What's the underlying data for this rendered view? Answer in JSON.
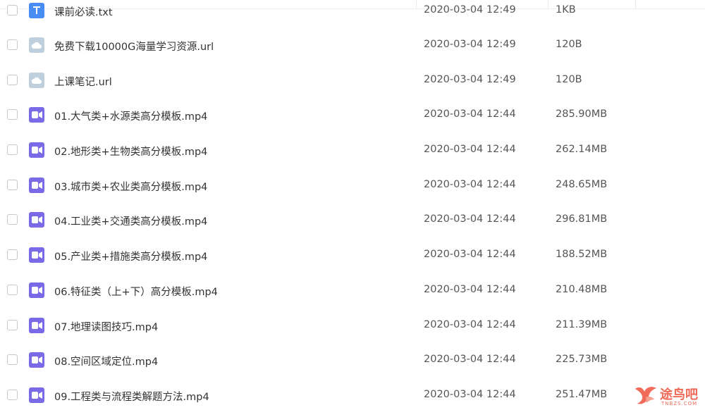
{
  "files": [
    {
      "name": "课前必读.txt",
      "date": "2020-03-04 12:49",
      "size": "1KB",
      "icon": "txt-file-icon",
      "type": "txt"
    },
    {
      "name": "免费下载10000G海量学习资源.url",
      "date": "2020-03-04 12:49",
      "size": "120B",
      "icon": "url-file-icon",
      "type": "url"
    },
    {
      "name": "上课笔记.url",
      "date": "2020-03-04 12:49",
      "size": "120B",
      "icon": "url-file-icon",
      "type": "url"
    },
    {
      "name": "01.大气类+水源类高分模板.mp4",
      "date": "2020-03-04 12:44",
      "size": "285.90MB",
      "icon": "video-file-icon",
      "type": "video"
    },
    {
      "name": "02.地形类+生物类高分模板.mp4",
      "date": "2020-03-04 12:44",
      "size": "262.14MB",
      "icon": "video-file-icon",
      "type": "video"
    },
    {
      "name": "03.城市类+农业类高分模板.mp4",
      "date": "2020-03-04 12:44",
      "size": "248.65MB",
      "icon": "video-file-icon",
      "type": "video"
    },
    {
      "name": "04.工业类+交通类高分模板.mp4",
      "date": "2020-03-04 12:44",
      "size": "296.81MB",
      "icon": "video-file-icon",
      "type": "video"
    },
    {
      "name": "05.产业类+措施类高分模板.mp4",
      "date": "2020-03-04 12:44",
      "size": "188.52MB",
      "icon": "video-file-icon",
      "type": "video"
    },
    {
      "name": "06.特征类（上+下）高分模板.mp4",
      "date": "2020-03-04 12:44",
      "size": "210.48MB",
      "icon": "video-file-icon",
      "type": "video"
    },
    {
      "name": "07.地理读图技巧.mp4",
      "date": "2020-03-04 12:44",
      "size": "211.39MB",
      "icon": "video-file-icon",
      "type": "video"
    },
    {
      "name": "08.空间区域定位.mp4",
      "date": "2020-03-04 12:44",
      "size": "225.73MB",
      "icon": "video-file-icon",
      "type": "video"
    },
    {
      "name": "09.工程类与流程类解题方法.mp4",
      "date": "2020-03-04 12:44",
      "size": "251.47MB",
      "icon": "video-file-icon",
      "type": "video"
    }
  ],
  "watermark": {
    "text": "途鸟吧",
    "sub": "TNBZS.COM",
    "color": "#f06b5a"
  },
  "colors": {
    "txt_icon": "#4a8cf5",
    "url_icon": "#bfcfdd",
    "video_icon": "#7b6ae8"
  }
}
